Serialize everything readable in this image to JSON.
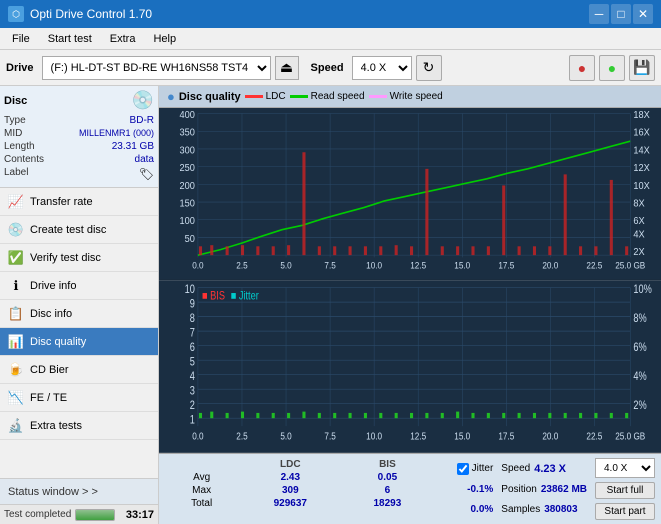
{
  "titlebar": {
    "title": "Opti Drive Control 1.70",
    "icon": "⬡",
    "minimize": "─",
    "maximize": "□",
    "close": "✕"
  },
  "menubar": {
    "items": [
      "File",
      "Start test",
      "Extra",
      "Help"
    ]
  },
  "toolbar": {
    "drive_label": "Drive",
    "drive_value": "(F:)  HL-DT-ST BD-RE  WH16NS58 TST4",
    "speed_label": "Speed",
    "speed_value": "4.0 X",
    "eject_icon": "⏏"
  },
  "disc": {
    "section_title": "Disc",
    "type_label": "Type",
    "type_value": "BD-R",
    "mid_label": "MID",
    "mid_value": "MILLENMR1 (000)",
    "length_label": "Length",
    "length_value": "23.31 GB",
    "contents_label": "Contents",
    "contents_value": "data",
    "label_label": "Label",
    "label_value": ""
  },
  "nav": {
    "items": [
      {
        "id": "transfer-rate",
        "label": "Transfer rate",
        "icon": "📈"
      },
      {
        "id": "create-test-disc",
        "label": "Create test disc",
        "icon": "💿"
      },
      {
        "id": "verify-test-disc",
        "label": "Verify test disc",
        "icon": "✅"
      },
      {
        "id": "drive-info",
        "label": "Drive info",
        "icon": "ℹ"
      },
      {
        "id": "disc-info",
        "label": "Disc info",
        "icon": "📋"
      },
      {
        "id": "disc-quality",
        "label": "Disc quality",
        "icon": "📊",
        "active": true
      },
      {
        "id": "cd-bier",
        "label": "CD Bier",
        "icon": "🍺"
      },
      {
        "id": "fe-te",
        "label": "FE / TE",
        "icon": "📉"
      },
      {
        "id": "extra-tests",
        "label": "Extra tests",
        "icon": "🔬"
      }
    ]
  },
  "status_window": {
    "label": "Status window > >"
  },
  "chart_header": {
    "title": "Disc quality",
    "legend": [
      {
        "label": "LDC",
        "color": "#ff3333"
      },
      {
        "label": "Read speed",
        "color": "#00cc00"
      },
      {
        "label": "Write speed",
        "color": "#ff99ff"
      }
    ]
  },
  "chart_top": {
    "y_labels": [
      "400",
      "350",
      "300",
      "250",
      "200",
      "150",
      "100",
      "50"
    ],
    "y_right": [
      "18X",
      "16X",
      "14X",
      "12X",
      "10X",
      "8X",
      "6X",
      "4X",
      "2X"
    ],
    "x_labels": [
      "0.0",
      "2.5",
      "5.0",
      "7.5",
      "10.0",
      "12.5",
      "15.0",
      "17.5",
      "20.0",
      "22.5",
      "25.0 GB"
    ]
  },
  "chart_bottom": {
    "legend": [
      {
        "label": "BIS",
        "color": "#ff3333"
      },
      {
        "label": "Jitter",
        "color": "#00cccc"
      }
    ],
    "y_labels": [
      "10",
      "9",
      "8",
      "7",
      "6",
      "5",
      "4",
      "3",
      "2",
      "1"
    ],
    "y_right": [
      "10%",
      "8%",
      "6%",
      "4%",
      "2%"
    ],
    "x_labels": [
      "0.0",
      "2.5",
      "5.0",
      "7.5",
      "10.0",
      "12.5",
      "15.0",
      "17.5",
      "20.0",
      "22.5",
      "25.0 GB"
    ]
  },
  "stats": {
    "headers": [
      "",
      "LDC",
      "BIS",
      "",
      "Jitter"
    ],
    "rows": [
      {
        "label": "Avg",
        "ldc": "2.43",
        "bis": "0.05",
        "jitter": "-0.1%"
      },
      {
        "label": "Max",
        "ldc": "309",
        "bis": "6",
        "jitter": "0.0%"
      },
      {
        "label": "Total",
        "ldc": "929637",
        "bis": "18293",
        "jitter": ""
      }
    ],
    "jitter_check": "✓",
    "jitter_label": "Jitter",
    "speed_label": "Speed",
    "speed_value": "4.23 X",
    "speed_select": "4.0 X",
    "position_label": "Position",
    "position_value": "23862 MB",
    "samples_label": "Samples",
    "samples_value": "380803",
    "start_full": "Start full",
    "start_part": "Start part"
  },
  "progress": {
    "label": "Test completed",
    "percent": 100,
    "time": "33:17"
  }
}
